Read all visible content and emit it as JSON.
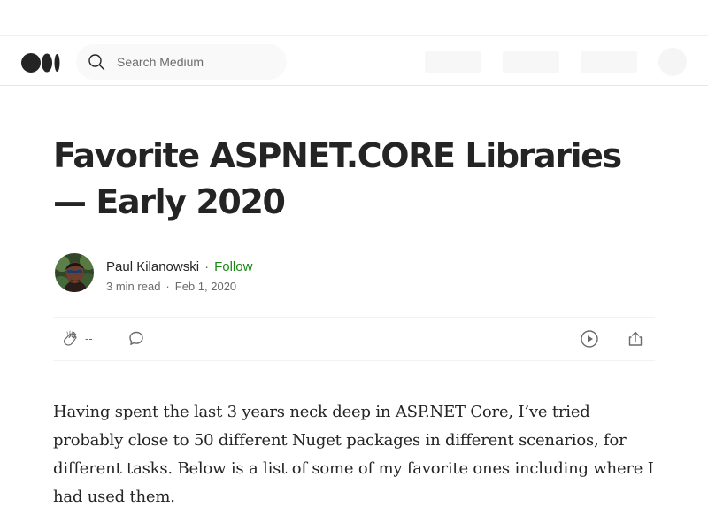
{
  "header": {
    "search": {
      "placeholder": "Search Medium",
      "value": ""
    },
    "logo_icon": "medium-logo-icon",
    "search_icon": "search-icon"
  },
  "article": {
    "title": "Favorite ASPNET.CORE Libraries — Early 2020",
    "author": {
      "name": "Paul Kilanowski",
      "follow_label": "Follow",
      "avatar_icon": "author-avatar"
    },
    "meta": {
      "read_time": "3 min read",
      "separator": "·",
      "date": "Feb 1, 2020"
    },
    "actions": {
      "clap_count": "--",
      "icons": {
        "clap": "clap-icon",
        "comment": "comment-icon",
        "listen": "play-icon",
        "share": "share-icon"
      }
    },
    "body": {
      "paragraph_1": "Having spent the last 3 years neck deep in ASP.NET Core, I’ve tried probably close to 50 different Nuget packages in different scenarios, for different tasks. Below is a list of some of my favorite ones including where I had used them."
    }
  },
  "colors": {
    "text": "#242424",
    "muted": "#6b6b6b",
    "follow": "#1a8917",
    "divider": "#f2f2f2",
    "search_background": "#f9f9f9"
  }
}
